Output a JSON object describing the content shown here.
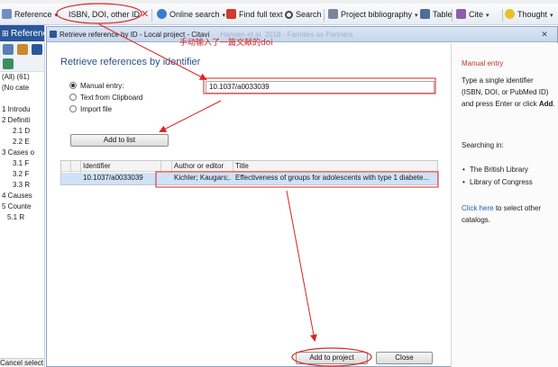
{
  "toolbar": {
    "reference_label": "Reference",
    "isbn_label": "ISBN, DOI, other ID",
    "online_search_label": "Online search",
    "find_full_text_label": "Find full text",
    "search_label": "Search",
    "project_bibliography_label": "Project bibliography",
    "table_label": "Table",
    "cite_label": "Cite",
    "thought_label": "Thought"
  },
  "left_panel": {
    "header": "References",
    "items": [
      "(All) (61)",
      "(No cate",
      "",
      "1 Introdu",
      "2 Definiti",
      "2.1 D",
      "2.2 E",
      "3 Cases o",
      "3.1 F",
      "3.2 F",
      "3.3 R",
      "4 Causes",
      "5 Counte",
      "5.1 R"
    ],
    "status": "Cancel select"
  },
  "dialog": {
    "title": "Retrieve reference by ID - Local project - Citavi",
    "title_ghost": "Hansen et al. 2018 - Families as Partners",
    "heading": "Retrieve references by identifier",
    "options": {
      "manual_entry": "Manual entry:",
      "text_from_clipboard": "Text from Clipboard",
      "import_file": "Import file"
    },
    "manual_entry_value": "10.1037/a0033039",
    "add_to_list_label": "Add to list",
    "annotation": "手动输入了一篇文献的doi",
    "grid": {
      "columns": [
        "Identifier",
        "Author or editor",
        "Title"
      ],
      "rows": [
        {
          "identifier": "10.1037/a0033039",
          "author": "Kichler; Kaugars;...",
          "title": "Effectiveness of groups for adolescents with type 1 diabete..."
        }
      ]
    },
    "add_to_project_label": "Add to project",
    "close_label": "Close",
    "side": {
      "title": "Manual entry",
      "instruction_part1": "Type a single identifier (ISBN, DOI, or PubMed ID) and press Enter or click",
      "instruction_bold": "Add",
      "instruction_end": ".",
      "searching_in": "Searching in:",
      "catalogs": [
        "The British Library",
        "Library of Congress"
      ],
      "click_here": "Click here",
      "select_other_catalogs": "to select other catalogs."
    }
  },
  "colors": {
    "accent": "#2b579a",
    "annotation": "#dd2222",
    "selected_row": "#cfe2f7"
  }
}
